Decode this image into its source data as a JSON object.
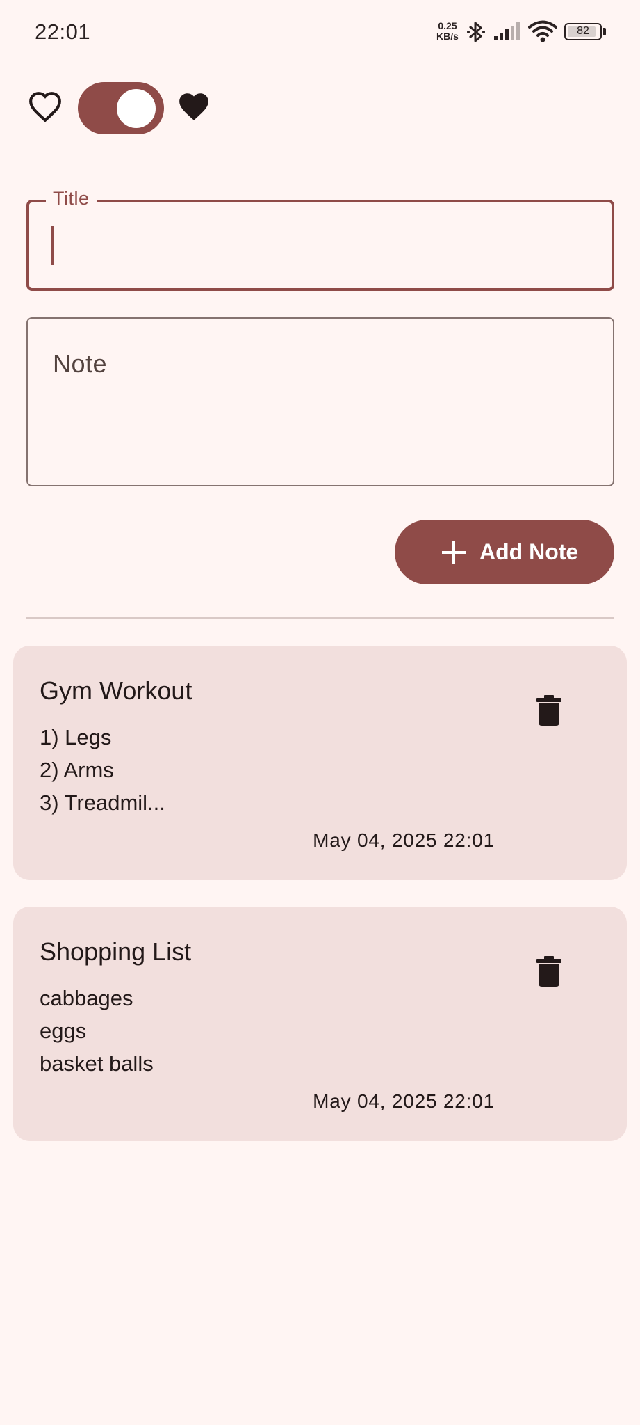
{
  "status_bar": {
    "time": "22:01",
    "net_speed_value": "0.25",
    "net_speed_unit": "KB/s",
    "battery_level": "82",
    "icons": [
      "bluetooth-icon",
      "signal-icon",
      "wifi-icon",
      "battery-icon"
    ]
  },
  "favorites_toggle": {
    "state": "on",
    "left_icon": "heart-outline-icon",
    "right_icon": "heart-filled-icon"
  },
  "form": {
    "title_label": "Title",
    "title_value": "",
    "note_placeholder": "Note",
    "note_value": "",
    "add_button_label": "Add Note",
    "add_button_icon": "plus-icon"
  },
  "notes": [
    {
      "title": "Gym Workout",
      "lines": [
        "1) Legs",
        "2) Arms",
        "3) Treadmil..."
      ],
      "date": "May 04, 2025 22:01"
    },
    {
      "title": "Shopping List",
      "lines": [
        "cabbages",
        "eggs",
        "basket balls"
      ],
      "date": "May 04, 2025 22:01"
    }
  ],
  "colors": {
    "background": "#fff5f3",
    "primary": "#8f4b48",
    "card": "#f2dfdd",
    "text": "#231919"
  }
}
